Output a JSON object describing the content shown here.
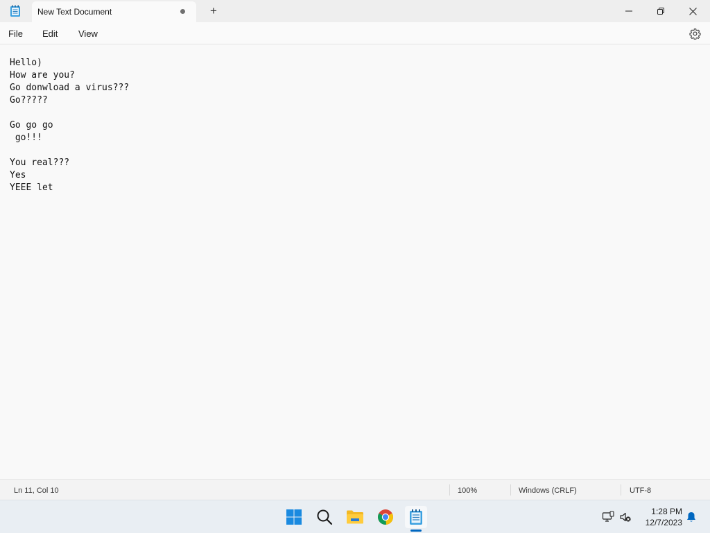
{
  "window": {
    "tab_title": "New Text Document",
    "new_tab": "+"
  },
  "menu": {
    "file": "File",
    "edit": "Edit",
    "view": "View"
  },
  "editor": {
    "text": "Hello)\nHow are you?\nGo donwload a virus???\nGo?????\n\nGo go go\n go!!!\n\nYou real???\nYes\nYEEE let"
  },
  "status": {
    "position": "Ln 11, Col 10",
    "zoom": "100%",
    "line_ending": "Windows (CRLF)",
    "encoding": "UTF-8"
  },
  "taskbar": {
    "apps": [
      "start-icon",
      "search-icon",
      "file-explorer-icon",
      "chrome-icon",
      "notepad-icon"
    ],
    "time": "1:28 PM",
    "date": "12/7/2023"
  },
  "colors": {
    "accent": "#0067c0",
    "background": "#f3f3f3",
    "editor_bg": "#f9f9f9"
  }
}
